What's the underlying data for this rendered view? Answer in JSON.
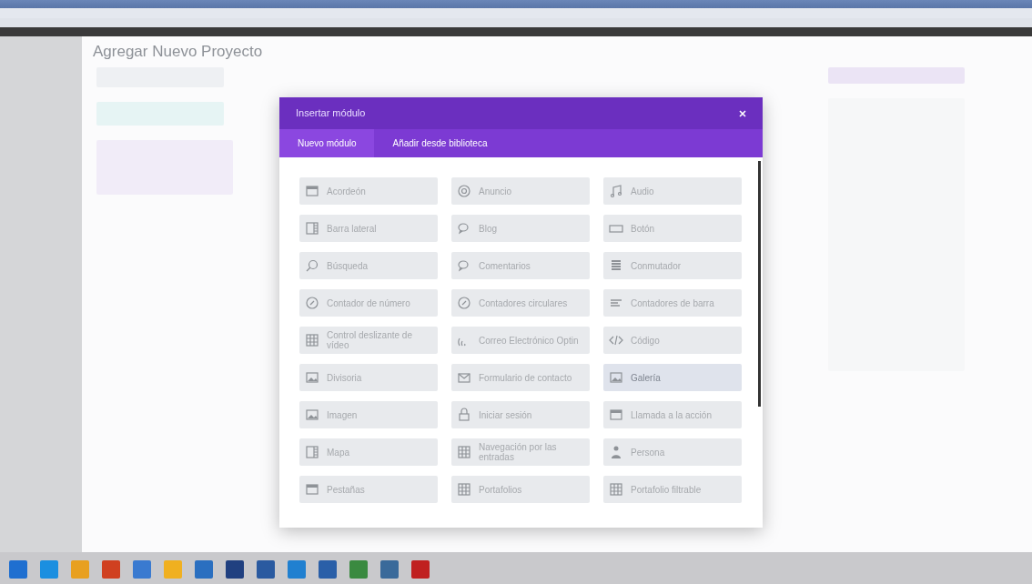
{
  "page": {
    "heading": "Agregar Nuevo Proyecto"
  },
  "modal": {
    "title": "Insertar módulo",
    "tabs": [
      {
        "label": "Nuevo módulo",
        "selected": true
      },
      {
        "label": "Añadir desde biblioteca",
        "selected": false
      }
    ],
    "modules": [
      {
        "label": "Acordeón",
        "kind": "window",
        "hovered": false
      },
      {
        "label": "Anuncio",
        "kind": "target",
        "hovered": false
      },
      {
        "label": "Audio",
        "kind": "music",
        "hovered": false
      },
      {
        "label": "Barra lateral",
        "kind": "columns",
        "hovered": false
      },
      {
        "label": "Blog",
        "kind": "chat",
        "hovered": false
      },
      {
        "label": "Botón",
        "kind": "rectangle",
        "hovered": false
      },
      {
        "label": "Búsqueda",
        "kind": "search",
        "hovered": false
      },
      {
        "label": "Comentarios",
        "kind": "chat",
        "hovered": false
      },
      {
        "label": "Conmutador",
        "kind": "list",
        "hovered": false
      },
      {
        "label": "Contador de número",
        "kind": "circle",
        "hovered": false
      },
      {
        "label": "Contadores circulares",
        "kind": "circle",
        "hovered": false
      },
      {
        "label": "Contadores de barra",
        "kind": "bars",
        "hovered": false
      },
      {
        "label": "Control deslizante de vídeo",
        "kind": "grid",
        "hovered": false
      },
      {
        "label": "Correo Electrónico Optin",
        "kind": "signal",
        "hovered": false
      },
      {
        "label": "Código",
        "kind": "code",
        "hovered": false
      },
      {
        "label": "Divisoria",
        "kind": "picture",
        "hovered": false
      },
      {
        "label": "Formulario de contacto",
        "kind": "envelope",
        "hovered": false
      },
      {
        "label": "Galería",
        "kind": "picture",
        "hovered": true
      },
      {
        "label": "Imagen",
        "kind": "picture",
        "hovered": false
      },
      {
        "label": "Iniciar sesión",
        "kind": "lock",
        "hovered": false
      },
      {
        "label": "Llamada a la acción",
        "kind": "window",
        "hovered": false
      },
      {
        "label": "Mapa",
        "kind": "columns",
        "hovered": false
      },
      {
        "label": "Navegación por las entradas",
        "kind": "grid",
        "hovered": false
      },
      {
        "label": "Persona",
        "kind": "person",
        "hovered": false
      },
      {
        "label": "Pestañas",
        "kind": "window",
        "hovered": false
      },
      {
        "label": "Portafolios",
        "kind": "grid",
        "hovered": false
      },
      {
        "label": "Portafolio filtrable",
        "kind": "grid",
        "hovered": false
      }
    ]
  }
}
